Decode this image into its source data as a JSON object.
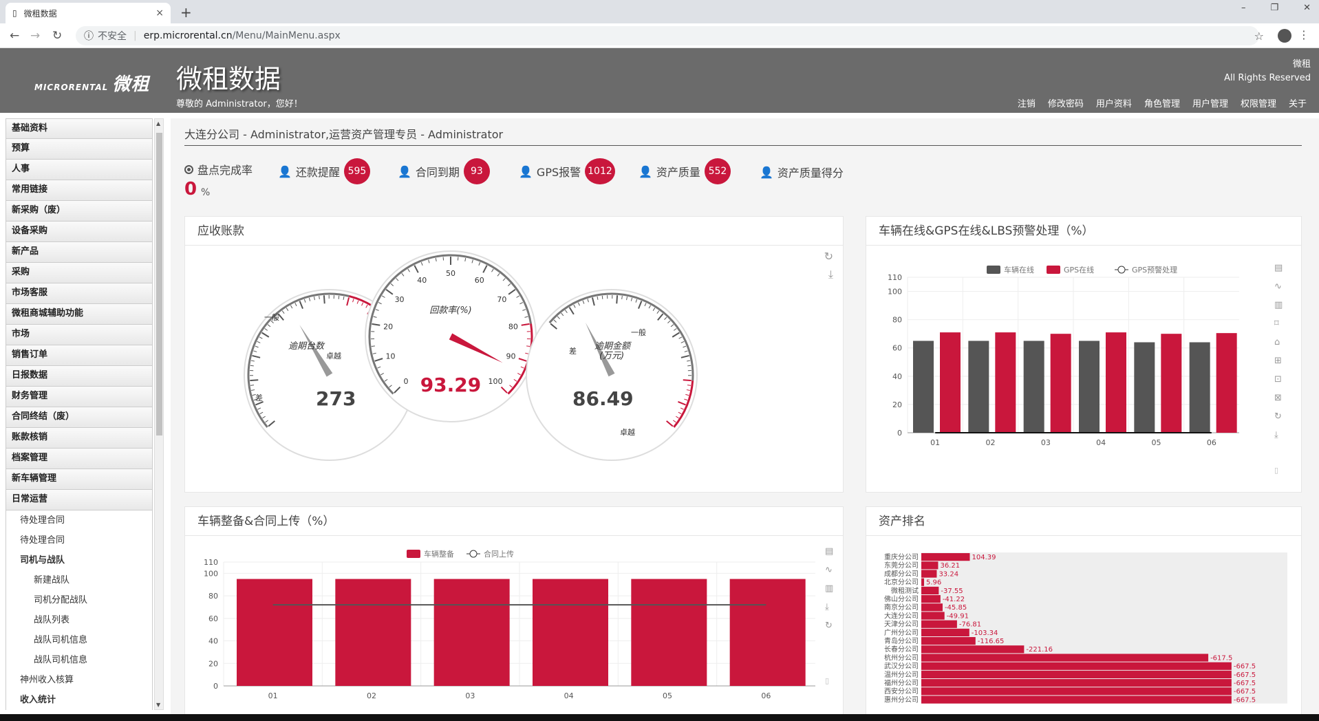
{
  "browser": {
    "tab_title": "微租数据",
    "tab_close": "×",
    "new_tab": "+",
    "minimize": "–",
    "restore": "❐",
    "close": "✕",
    "back": "←",
    "forward": "→",
    "reload": "↻",
    "info_icon": "ⓘ",
    "insecure": "不安全",
    "host": "erp.microrental.cn",
    "path": "/Menu/MainMenu.aspx",
    "star": "☆",
    "kebab": "⋮"
  },
  "header": {
    "logo_small": "MICRORENTAL",
    "logo": "微租",
    "title": "微租数据",
    "welcome": "尊敬的 Administrator，您好！",
    "right_line1": "微租",
    "right_line2": "All Rights Reserved",
    "nav": [
      "注销",
      "修改密码",
      "用户资料",
      "角色管理",
      "用户管理",
      "权限管理",
      "关于"
    ]
  },
  "sidebar": {
    "menu": [
      "基础资料",
      "预算",
      "人事",
      "常用链接",
      "新采购（废）",
      "设备采购",
      "新产品",
      "采购",
      "市场客服",
      "微租商城辅助功能",
      "市场",
      "销售订单",
      "日报数据",
      "财务管理",
      "合同终结（废）",
      "账款核销",
      "档案管理",
      "新车辆管理",
      "日常运营"
    ],
    "sub": [
      {
        "label": "待处理合同",
        "lvl": 1,
        "bold": false
      },
      {
        "label": "待处理合同",
        "lvl": 1,
        "bold": false
      },
      {
        "label": "司机与战队",
        "lvl": 1,
        "bold": true
      },
      {
        "label": "新建战队",
        "lvl": 2,
        "bold": false
      },
      {
        "label": "司机分配战队",
        "lvl": 2,
        "bold": false
      },
      {
        "label": "战队列表",
        "lvl": 2,
        "bold": false
      },
      {
        "label": "战队司机信息",
        "lvl": 2,
        "bold": false
      },
      {
        "label": "战队司机信息",
        "lvl": 2,
        "bold": false
      },
      {
        "label": "神州收入核算",
        "lvl": 1,
        "bold": false
      },
      {
        "label": "收入统计",
        "lvl": 1,
        "bold": true
      }
    ],
    "scroll_up": "▲",
    "scroll_down": "▼"
  },
  "breadcrumb": "大连分公司 - Administrator,运营资产管理专员 - Administrator",
  "kpis": {
    "inventory_label": "盘点完成率",
    "inventory_value": "0",
    "inventory_unit": "%",
    "repay_label": "还款提醒",
    "repay_count": "595",
    "contract_label": "合同到期",
    "contract_count": "93",
    "gps_label": "GPS报警",
    "gps_count": "1012",
    "quality_label": "资产质量",
    "quality_count": "552",
    "score_label": "资产质量得分"
  },
  "panels": {
    "receivable": "应收账款",
    "online": "车辆在线&GPS在线&LBS预警处理（%）",
    "prep": "车辆整备&合同上传（%）",
    "ranking": "资产排名"
  },
  "gauges": {
    "left": {
      "title": "逾期台数",
      "value": "273",
      "low": "差",
      "mid": "一般",
      "high": "卓越",
      "fraction": 0.55
    },
    "center": {
      "title": "回款率(%)",
      "value": "93.29",
      "ticks": [
        "0",
        "10",
        "20",
        "30",
        "40",
        "50",
        "60",
        "70",
        "80",
        "90",
        "100"
      ],
      "fraction": 0.9329
    },
    "right": {
      "title1": "逾期金额",
      "title2": "(万元)",
      "value": "86.49",
      "low": "差",
      "mid": "一般",
      "high": "卓越",
      "fraction": 0.13
    }
  },
  "colors": {
    "accent": "#c9173c",
    "dark": "#555555",
    "header": "#6b6b6b"
  },
  "chart_data": [
    {
      "type": "bar",
      "title": "车辆在线&GPS在线&LBS预警处理（%）",
      "categories": [
        "01",
        "02",
        "03",
        "04",
        "05",
        "06"
      ],
      "ylim": [
        0,
        110
      ],
      "yticks": [
        "0",
        "20",
        "40",
        "60",
        "80",
        "100",
        "110"
      ],
      "series": [
        {
          "name": "车辆在线",
          "values": [
            65,
            65,
            65,
            65,
            64,
            64
          ]
        },
        {
          "name": "GPS在线",
          "values": [
            71,
            71,
            70,
            71,
            70,
            70.5
          ]
        },
        {
          "name": "GPS预警处理",
          "values": [
            0,
            0,
            0,
            0,
            0,
            0
          ]
        }
      ]
    },
    {
      "type": "bar",
      "title": "车辆整备&合同上传（%）",
      "categories": [
        "01",
        "02",
        "03",
        "04",
        "05",
        "06"
      ],
      "ylim": [
        0,
        110
      ],
      "yticks": [
        "0",
        "20",
        "40",
        "60",
        "80",
        "100",
        "110"
      ],
      "series": [
        {
          "name": "车辆整备",
          "values": [
            95,
            95,
            95,
            95,
            95,
            95
          ]
        },
        {
          "name": "合同上传",
          "values": [
            72,
            72,
            72,
            72,
            72,
            72
          ]
        }
      ]
    },
    {
      "type": "bar",
      "title": "资产排名",
      "categories": [
        "重庆分公司",
        "东莞分公司",
        "成都分公司",
        "北京分公司",
        "微租测试",
        "佛山分公司",
        "南京分公司",
        "大连分公司",
        "天津分公司",
        "广州分公司",
        "青岛分公司",
        "长春分公司",
        "杭州分公司",
        "武汉分公司",
        "温州分公司",
        "福州分公司",
        "西安分公司",
        "惠州分公司"
      ],
      "values": [
        104.39,
        36.21,
        33.24,
        5.96,
        -37.55,
        -41.22,
        -45.85,
        -49.91,
        -76.81,
        -103.34,
        -116.65,
        -221.16,
        -617.5,
        -667.5,
        -667.5,
        -667.5,
        -667.5,
        -667.5
      ],
      "labels": [
        "104.39",
        "36.21",
        "33.24",
        "5.96",
        "-37.55",
        "-41.22",
        "-45.85",
        "-49.91",
        "-76.81",
        "-103.34",
        "-116.65",
        "-221.16",
        "-617.5",
        "-667.5",
        "-667.5",
        "-667.5",
        "-667.5",
        "-667.5"
      ]
    }
  ]
}
